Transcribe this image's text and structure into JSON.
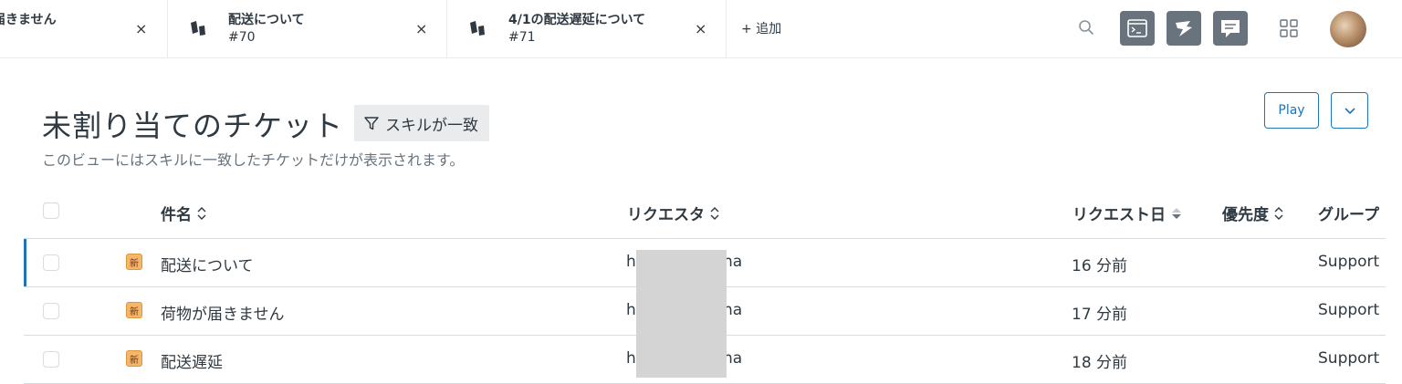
{
  "tabs": [
    {
      "title": "届きません",
      "close": "×"
    },
    {
      "title": "配送について",
      "sub": "#70",
      "close": "×"
    },
    {
      "title": "4/1の配送遅延について",
      "sub": "#71",
      "close": "×"
    }
  ],
  "add_tab": "+ 追加",
  "header": {
    "title": "未割り当てのチケット",
    "filter": "スキルが一致",
    "subtitle": "このビューにはスキルに一致したチケットだけが表示されます。",
    "play": "Play"
  },
  "columns": {
    "subject": "件名",
    "requester": "リクエスタ",
    "requested": "リクエスト日",
    "priority": "優先度",
    "group": "グループ"
  },
  "rows": [
    {
      "badge": "新",
      "subject": "配送について",
      "req_pre": "h",
      "req_post": "na",
      "requested": "16 分前",
      "group": "Support"
    },
    {
      "badge": "新",
      "subject": "荷物が届きません",
      "req_pre": "h",
      "req_post": "na",
      "requested": "17 分前",
      "group": "Support"
    },
    {
      "badge": "新",
      "subject": "配送遅延",
      "req_pre": "h",
      "req_post": "na",
      "requested": "18 分前",
      "group": "Support"
    }
  ],
  "colors": {
    "accent": "#1f73b7",
    "badge_new": "#f4b669",
    "app_icon_bg": "#68737d"
  },
  "icons": [
    "search-icon",
    "terminal-app-icon",
    "flag-app-icon",
    "chat-app-icon",
    "grid-icon",
    "sort-icon",
    "filter-icon",
    "chevron-down-icon"
  ]
}
